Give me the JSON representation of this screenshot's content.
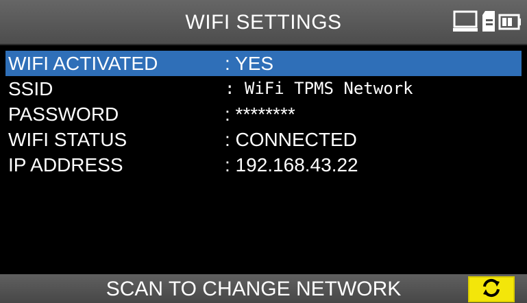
{
  "header": {
    "title": "WIFI SETTINGS",
    "icons": [
      "computer-monitor-icon",
      "sd-card-icon",
      "battery-icon"
    ]
  },
  "settings": {
    "rows": [
      {
        "label": "WIFI ACTIVATED",
        "value": ": YES",
        "selected": true
      },
      {
        "label": "SSID",
        "value": ": WiFi TPMS Network",
        "selected": false
      },
      {
        "label": "PASSWORD",
        "value": ": ********",
        "selected": false
      },
      {
        "label": "WIFI STATUS",
        "value": ": CONNECTED",
        "selected": false
      },
      {
        "label": "IP ADDRESS",
        "value": ": 192.168.43.22",
        "selected": false
      }
    ]
  },
  "footer": {
    "text": "SCAN TO CHANGE NETWORK",
    "button_icon": "refresh-icon"
  },
  "colors": {
    "selection": "#2f6fb8",
    "header_bg": "#555555",
    "button_bg": "#f3e60a"
  }
}
